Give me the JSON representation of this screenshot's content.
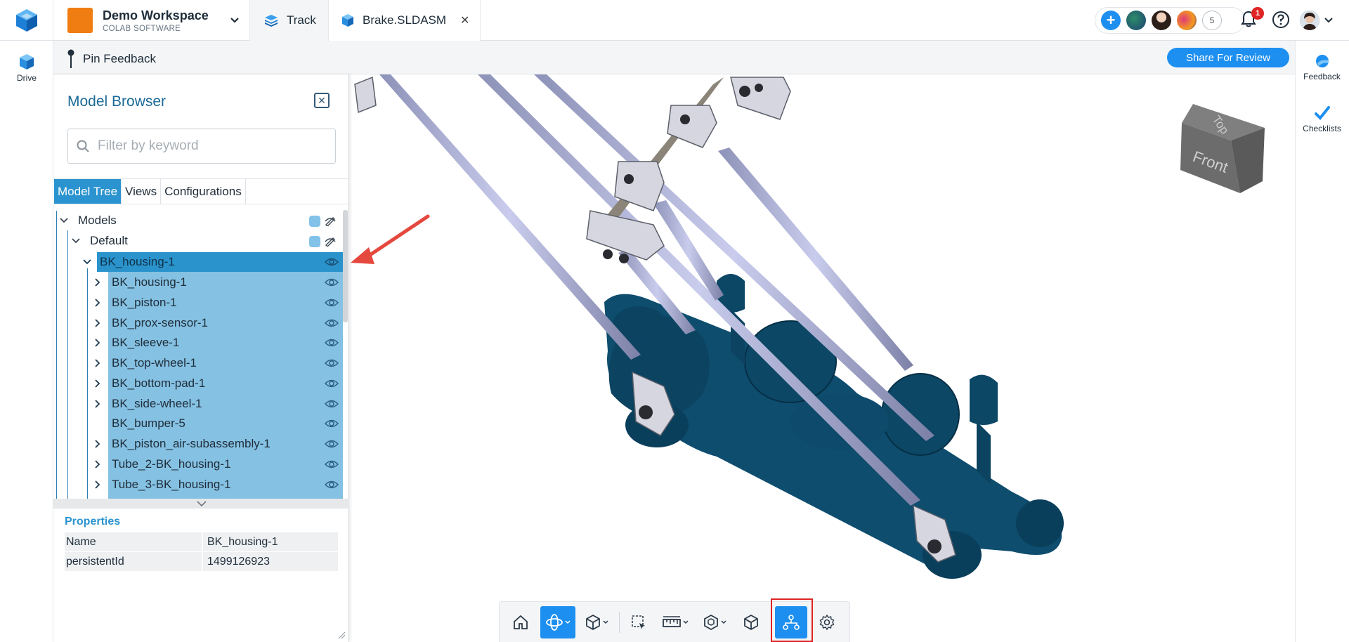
{
  "topbar": {
    "workspace_name": "Demo Workspace",
    "workspace_org": "COLAB SOFTWARE",
    "tabs": [
      {
        "label": "Track"
      },
      {
        "label": "Brake.SLDASM",
        "close": "✕"
      }
    ],
    "collaborator_count": "5",
    "notification_count": "1"
  },
  "left_rail": {
    "drive_label": "Drive"
  },
  "right_rail": {
    "feedback_label": "Feedback",
    "checklists_label": "Checklists"
  },
  "pinbar": {
    "pin_label": "Pin Feedback",
    "share_label": "Share For Review"
  },
  "model_browser": {
    "title": "Model Browser",
    "filter_placeholder": "Filter by keyword",
    "tabs": [
      "Model Tree",
      "Views",
      "Configurations"
    ],
    "active_tab": "Model Tree",
    "tree": {
      "root": "Models",
      "config": "Default",
      "selected": "BK_housing-1",
      "children": [
        "BK_housing-1",
        "BK_piston-1",
        "BK_prox-sensor-1",
        "BK_sleeve-1",
        "BK_top-wheel-1",
        "BK_bottom-pad-1",
        "BK_side-wheel-1",
        "BK_bumper-5",
        "BK_piston_air-subassembly-1",
        "Tube_2-BK_housing-1",
        "Tube_3-BK_housing-1"
      ]
    }
  },
  "properties": {
    "title": "Properties",
    "rows": [
      {
        "key": "Name",
        "value": "BK_housing-1"
      },
      {
        "key": "persistentId",
        "value": "1499126923"
      }
    ]
  },
  "view_cube": {
    "top_label": "Top",
    "front_label": "Front"
  },
  "toolbar": {
    "items": [
      "home-icon",
      "orbit-icon",
      "view-cube-icon",
      "box-select-icon",
      "measure-icon",
      "explode-icon",
      "section-icon",
      "assembly-tree-icon",
      "settings-icon"
    ],
    "active": [
      "orbit-icon",
      "assembly-tree-icon"
    ]
  },
  "colors": {
    "accent": "#1d8ff0",
    "model": "#0e4d6e",
    "selection": "#2a93cc"
  }
}
